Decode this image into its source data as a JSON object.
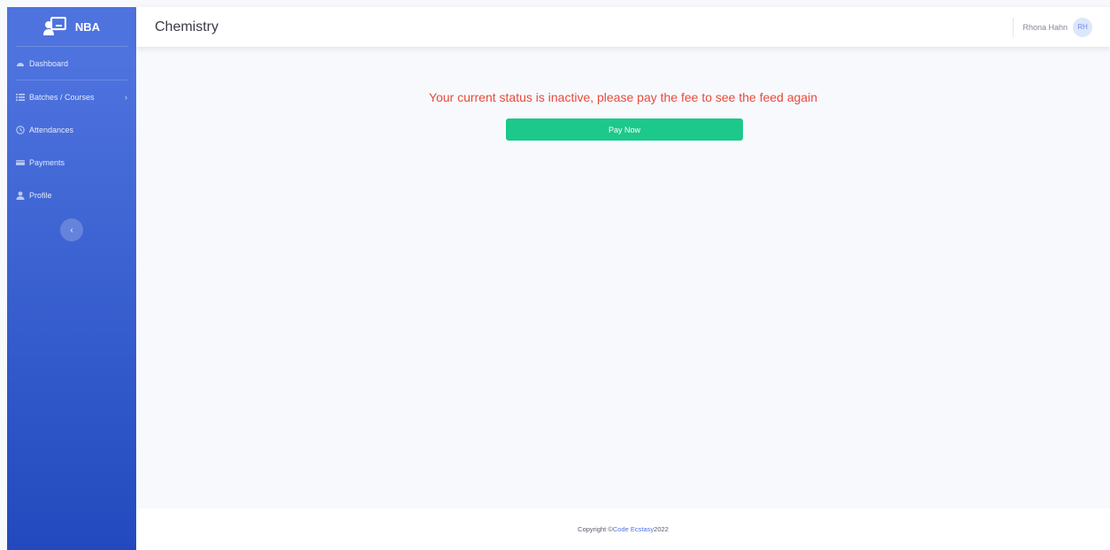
{
  "sidebar": {
    "brand": "NBA",
    "items": [
      {
        "label": "Dashboard",
        "icon": "dashboard-icon"
      },
      {
        "label": "Batches / Courses",
        "icon": "list-icon",
        "has_submenu": true
      },
      {
        "label": "Attendances",
        "icon": "clock-icon"
      },
      {
        "label": "Payments",
        "icon": "card-icon"
      },
      {
        "label": "Profile",
        "icon": "user-icon"
      }
    ],
    "collapse_icon": "chevron-left-icon"
  },
  "topbar": {
    "title": "Chemistry",
    "user_name": "Rhona Hahn",
    "user_initials": "RH"
  },
  "main": {
    "status_message": "Your current status is inactive, please pay the fee to see the feed again",
    "pay_button_label": "Pay Now"
  },
  "footer": {
    "prefix": "Copyright © ",
    "link_text": "Code Ecstasy",
    "suffix": " 2022"
  },
  "colors": {
    "sidebar_top": "#4e73df",
    "sidebar_bottom": "#224abe",
    "danger": "#e74a3b",
    "success": "#1cc88a"
  }
}
